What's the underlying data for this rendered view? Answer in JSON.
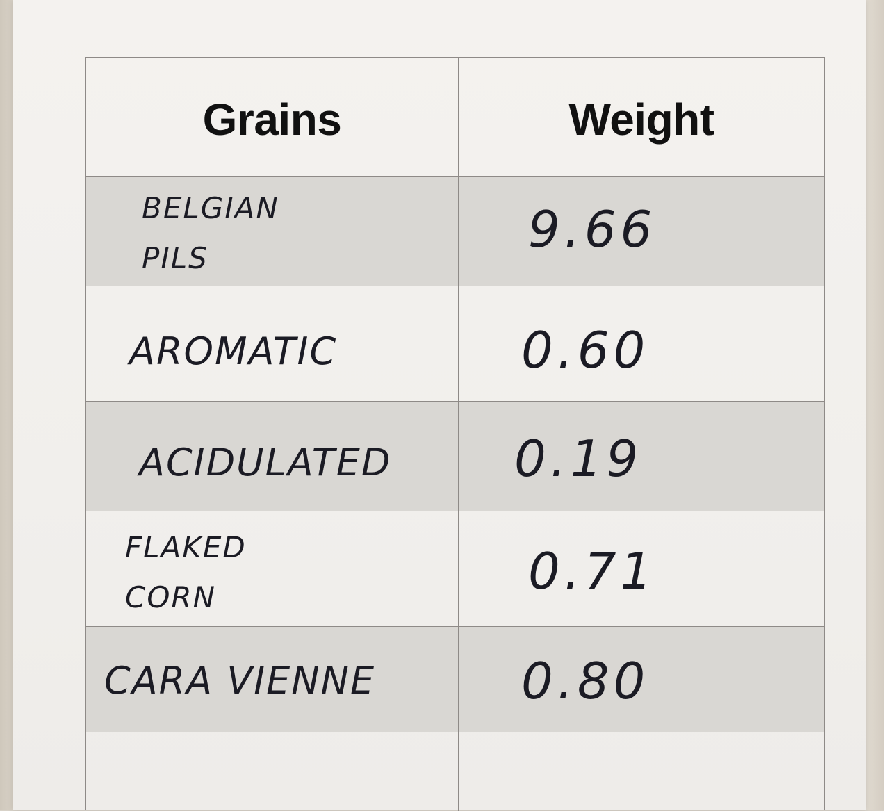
{
  "table": {
    "headers": {
      "grains": "Grains",
      "weight": "Weight"
    },
    "rows": [
      {
        "grain": "BELGIAN PILS",
        "weight": "9.66"
      },
      {
        "grain": "AROMATIC",
        "weight": "0.60"
      },
      {
        "grain": "ACIDULATED",
        "weight": "0.19"
      },
      {
        "grain": "FLAKED CORN",
        "weight": "0.71"
      },
      {
        "grain": "CARA VIENNE",
        "weight": "0.80"
      },
      {
        "grain": "",
        "weight": ""
      }
    ]
  }
}
